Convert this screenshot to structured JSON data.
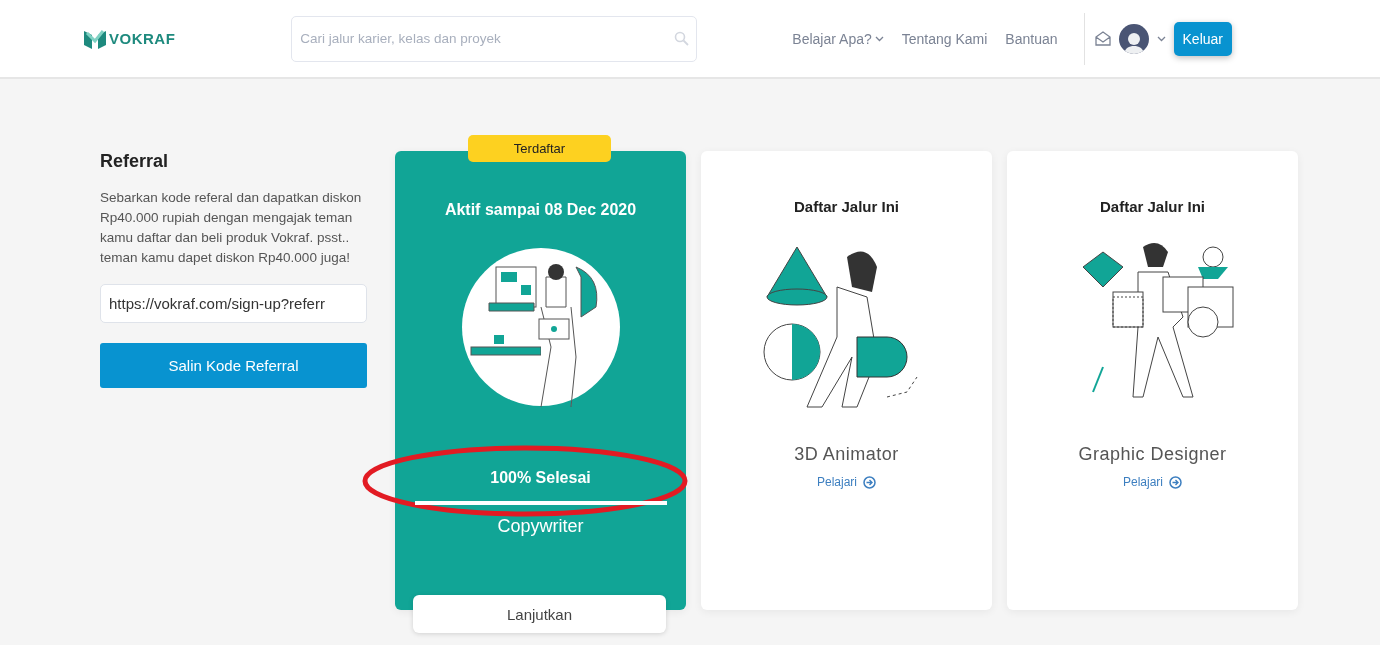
{
  "header": {
    "logo": "VOKRAF",
    "search": {
      "placeholder": "Cari jalur karier, kelas dan proyek"
    },
    "nav": [
      {
        "label": "Belajar Apa?",
        "dropdown": true
      },
      {
        "label": "Tentang Kami",
        "dropdown": false
      },
      {
        "label": "Bantuan",
        "dropdown": false
      }
    ],
    "logout": "Keluar"
  },
  "referral": {
    "title": "Referral",
    "description": "Sebarkan kode referal dan dapatkan diskon Rp40.000 rupiah dengan mengajak teman kamu daftar dan beli produk Vokraf. psst.. teman kamu dapet diskon Rp40.000 juga!",
    "link": "https://vokraf.com/sign-up?referr",
    "button": "Salin Kode Referral"
  },
  "cards": [
    {
      "kind": "enrolled",
      "badge": "Terdaftar",
      "heading": "Aktif sampai 08 Dec 2020",
      "progress_label": "100% Selesai",
      "level": 1.0,
      "name": "Copywriter",
      "action": "Lanjutkan",
      "highlighted": true
    },
    {
      "kind": "available",
      "heading": "Daftar Jalur Ini",
      "name": "3D Animator",
      "action": "Pelajari"
    },
    {
      "kind": "available",
      "heading": "Daftar Jalur Ini",
      "name": "Graphic Designer",
      "action": "Pelajari"
    }
  ]
}
